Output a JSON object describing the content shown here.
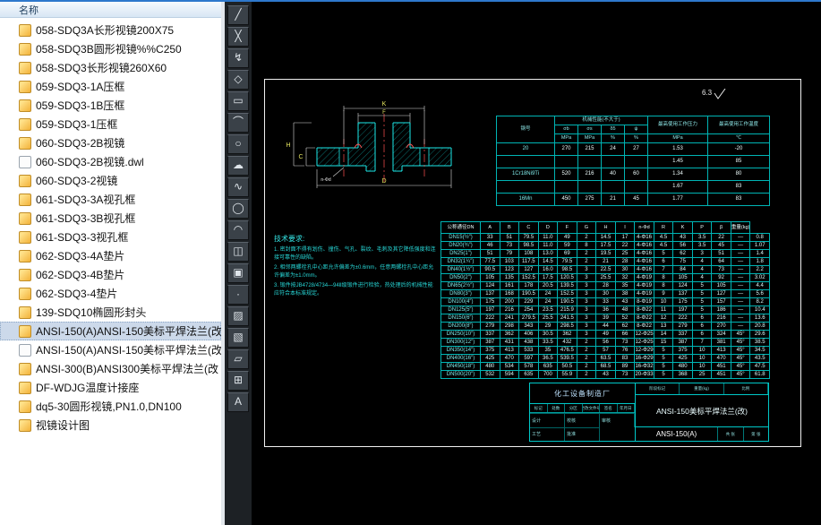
{
  "header": {
    "name_column": "名称"
  },
  "files": [
    {
      "name": "058-SDQ3A长形视镜200X75",
      "icon": "dwg",
      "selected": false
    },
    {
      "name": "058-SDQ3B圆形视镜%%C250",
      "icon": "dwg",
      "selected": false
    },
    {
      "name": "058-SDQ3长形视镜260X60",
      "icon": "dwg",
      "selected": false
    },
    {
      "name": "059-SDQ3-1A压框",
      "icon": "dwg",
      "selected": false
    },
    {
      "name": "059-SDQ3-1B压框",
      "icon": "dwg",
      "selected": false
    },
    {
      "name": "059-SDQ3-1压框",
      "icon": "dwg",
      "selected": false
    },
    {
      "name": "060-SDQ3-2B视镜",
      "icon": "dwg",
      "selected": false
    },
    {
      "name": "060-SDQ3-2B视镜.dwl",
      "icon": "plain",
      "selected": false
    },
    {
      "name": "060-SDQ3-2视镜",
      "icon": "dwg",
      "selected": false
    },
    {
      "name": "061-SDQ3-3A视孔框",
      "icon": "dwg",
      "selected": false
    },
    {
      "name": "061-SDQ3-3B视孔框",
      "icon": "dwg",
      "selected": false
    },
    {
      "name": "061-SDQ3-3视孔框",
      "icon": "dwg",
      "selected": false
    },
    {
      "name": "062-SDQ3-4A垫片",
      "icon": "dwg",
      "selected": false
    },
    {
      "name": "062-SDQ3-4B垫片",
      "icon": "dwg",
      "selected": false
    },
    {
      "name": "062-SDQ3-4垫片",
      "icon": "dwg",
      "selected": false
    },
    {
      "name": "139-SDQ10椭圆形封头",
      "icon": "dwg",
      "selected": false
    },
    {
      "name": "ANSI-150(A)ANSI-150美标平焊法兰(改",
      "icon": "dwg",
      "selected": true
    },
    {
      "name": "ANSI-150(A)ANSI-150美标平焊法兰(改",
      "icon": "plain",
      "selected": false
    },
    {
      "name": "ANSI-300(B)ANSI300美标平焊法兰(改",
      "icon": "dwg",
      "selected": false
    },
    {
      "name": "DF-WDJG温度计接座",
      "icon": "dwg",
      "selected": false
    },
    {
      "name": "dq5-30圆形视镜,PN1.0,DN100",
      "icon": "dwg",
      "selected": false
    },
    {
      "name": "视镜设计图",
      "icon": "dwg",
      "selected": false
    }
  ],
  "toolbar": [
    {
      "name": "line-tool",
      "glyph": "╱"
    },
    {
      "name": "construction-line-tool",
      "glyph": "╳"
    },
    {
      "name": "polyline-tool",
      "glyph": "↯"
    },
    {
      "name": "polygon-tool",
      "glyph": "◇"
    },
    {
      "name": "rectangle-tool",
      "glyph": "▭"
    },
    {
      "name": "arc-tool",
      "glyph": "⌒"
    },
    {
      "name": "circle-tool",
      "glyph": "○"
    },
    {
      "name": "revision-cloud-tool",
      "glyph": "☁"
    },
    {
      "name": "spline-tool",
      "glyph": "∿"
    },
    {
      "name": "ellipse-tool",
      "glyph": "◯"
    },
    {
      "name": "ellipse-arc-tool",
      "glyph": "◠"
    },
    {
      "name": "insert-block-tool",
      "glyph": "◫"
    },
    {
      "name": "make-block-tool",
      "glyph": "▣"
    },
    {
      "name": "point-tool",
      "glyph": "·"
    },
    {
      "name": "hatch-tool",
      "glyph": "▨"
    },
    {
      "name": "gradient-tool",
      "glyph": "▧"
    },
    {
      "name": "region-tool",
      "glyph": "▱"
    },
    {
      "name": "table-tool",
      "glyph": "⊞"
    },
    {
      "name": "mtext-tool",
      "glyph": "A"
    }
  ],
  "drawing": {
    "surface_finish": "6.3",
    "dims": {
      "k": "K",
      "f": "F",
      "d": "D",
      "c": "C",
      "h": "H",
      "nd": "n-Φd"
    },
    "rating_table": {
      "col1_header": "钢号",
      "mech_header": "机械性能(不大于)",
      "mech_cols": [
        "σb",
        "σs",
        "δ5",
        "ψ"
      ],
      "pressure_header": "最高使用工作压力",
      "temp_header": "最高使用工作温度",
      "units": [
        "MPa",
        "MPa",
        "%",
        "%",
        "MPa",
        "℃"
      ],
      "rows": [
        [
          "20",
          "270",
          "215",
          "24",
          "27",
          "1.53",
          "-20"
        ],
        [
          "",
          "",
          "",
          "",
          "",
          "1.45",
          "85"
        ],
        [
          "1Cr18Ni9Ti",
          "520",
          "216",
          "40",
          "60",
          "1.34",
          "80"
        ],
        [
          "",
          "",
          "",
          "",
          "",
          "1.67",
          "83"
        ],
        [
          "16Mn",
          "450",
          "275",
          "21",
          "45",
          "1.77",
          "83"
        ]
      ]
    },
    "main_table": {
      "headers": [
        "公称通径DN",
        "A",
        "B",
        "C",
        "D",
        "F",
        "G",
        "H",
        "I",
        "n-Φd",
        "R",
        "K",
        "P",
        "β",
        "重量(kg)"
      ],
      "rows": [
        [
          "DN15(½″)",
          "33",
          "51",
          "79.5",
          "11.0",
          "49",
          "2",
          "14.5",
          "17",
          "4-Φ16",
          "4.5",
          "43",
          "3.5",
          "22",
          "—",
          "0.8"
        ],
        [
          "DN20(¾″)",
          "46",
          "73",
          "98.5",
          "11.0",
          "59",
          "8",
          "17.5",
          "22",
          "4-Φ16",
          "4.5",
          "56",
          "3.5",
          "45",
          "—",
          "1.07"
        ],
        [
          "DN25(1″)",
          "51",
          "79",
          "108",
          "13.0",
          "69",
          "2",
          "19.5",
          "25",
          "4-Φ16",
          "5",
          "62",
          "3",
          "51",
          "—",
          "1.4"
        ],
        [
          "DN32(1¼″)",
          "77.5",
          "103",
          "117.5",
          "14.5",
          "79.5",
          "2",
          "21",
          "28",
          "4-Φ16",
          "6",
          "75",
          "4",
          "64",
          "—",
          "1.8"
        ],
        [
          "DN40(1½″)",
          "90.5",
          "123",
          "127",
          "16.0",
          "98.5",
          "3",
          "22.5",
          "30",
          "4-Φ16",
          "7",
          "84",
          "4",
          "73",
          "—",
          "2.2"
        ],
        [
          "DN50(2″)",
          "105",
          "135",
          "152.5",
          "17.5",
          "120.5",
          "3",
          "25.5",
          "32",
          "4-Φ19",
          "8",
          "105",
          "4",
          "92",
          "—",
          "3.02"
        ],
        [
          "DN65(2½″)",
          "124",
          "161",
          "178",
          "20.5",
          "139.5",
          "3",
          "28",
          "35",
          "4-Φ19",
          "8",
          "124",
          "5",
          "105",
          "—",
          "4.4"
        ],
        [
          "DN80(3″)",
          "137",
          "168",
          "190.5",
          "24",
          "152.5",
          "3",
          "30",
          "38",
          "4-Φ19",
          "9",
          "137",
          "5",
          "127",
          "—",
          "5.6"
        ],
        [
          "DN100(4″)",
          "175",
          "200",
          "229",
          "24",
          "190.5",
          "3",
          "33",
          "43",
          "8-Φ19",
          "10",
          "175",
          "5",
          "157",
          "—",
          "8.2"
        ],
        [
          "DN125(5″)",
          "197",
          "216",
          "254",
          "23.5",
          "215.9",
          "3",
          "36",
          "48",
          "8-Φ22",
          "11",
          "197",
          "5",
          "186",
          "—",
          "10.4"
        ],
        [
          "DN150(6″)",
          "222",
          "241",
          "279.5",
          "25.5",
          "241.5",
          "3",
          "39",
          "52",
          "8-Φ22",
          "12",
          "222",
          "6",
          "216",
          "—",
          "13.6"
        ],
        [
          "DN200(8″)",
          "279",
          "298",
          "343",
          "29",
          "298.5",
          "3",
          "44",
          "62",
          "8-Φ22",
          "13",
          "279",
          "6",
          "270",
          "—",
          "20.8"
        ],
        [
          "DN250(10″)",
          "337",
          "362",
          "406",
          "30.5",
          "362",
          "3",
          "49",
          "66",
          "12-Φ25",
          "14",
          "337",
          "6",
          "324",
          "45°",
          "29.6"
        ],
        [
          "DN300(12″)",
          "387",
          "431",
          "438",
          "33.5",
          "432",
          "2",
          "56",
          "73",
          "12-Φ25",
          "15",
          "387",
          "7",
          "381",
          "45°",
          "38.5"
        ],
        [
          "DN350(14″)",
          "375",
          "413",
          "533",
          "35",
          "476.5",
          "2",
          "57",
          "76",
          "12-Φ29",
          "5",
          "375",
          "10",
          "413",
          "45°",
          "34.5"
        ],
        [
          "DN400(16″)",
          "425",
          "470",
          "597",
          "36.5",
          "539.5",
          "2",
          "63.5",
          "83",
          "16-Φ29",
          "5",
          "425",
          "10",
          "470",
          "45°",
          "43.5"
        ],
        [
          "DN450(18″)",
          "480",
          "534",
          "578",
          "635",
          "50.5",
          "2",
          "68.5",
          "89",
          "16-Φ32",
          "5",
          "480",
          "10",
          "451",
          "45°",
          "47.5"
        ],
        [
          "DN500(20″)",
          "532",
          "594",
          "635",
          "700",
          "55.9",
          "2",
          "43",
          "73",
          "20-Φ33",
          "5",
          "368",
          "25",
          "451",
          "45°",
          "61.8"
        ]
      ]
    },
    "tech_notes": {
      "title": "技术要求:",
      "items": [
        "1. 密封面不得有划伤、撞伤、气孔、裂纹、毛刺及其它降低强度和连接可靠性的缺陷。",
        "2. 相邻两螺栓孔中心距允许偏差为±0.6mm，任意两螺栓孔中心距允许偏差为±1.0mm。",
        "3. 锻件按JB4728/4734—94Ⅱ级锻件进行检验，热处理后的机械性能应符合本标准规定。"
      ]
    },
    "title_block": {
      "company": "化工设备制造厂",
      "title": "ANSI-150美标平焊法兰(改)",
      "number": "ANSI-150(A)",
      "rev_headers": [
        "标记",
        "处数",
        "分区",
        "更改文件号",
        "签名",
        "年月日"
      ],
      "sig_labels": [
        "设计",
        "校核",
        "审核",
        "工艺",
        "批准"
      ],
      "info_labels": [
        "阶段标记",
        "重量(kg)",
        "比例"
      ],
      "sheet": [
        "共 张",
        "第 张"
      ]
    }
  }
}
